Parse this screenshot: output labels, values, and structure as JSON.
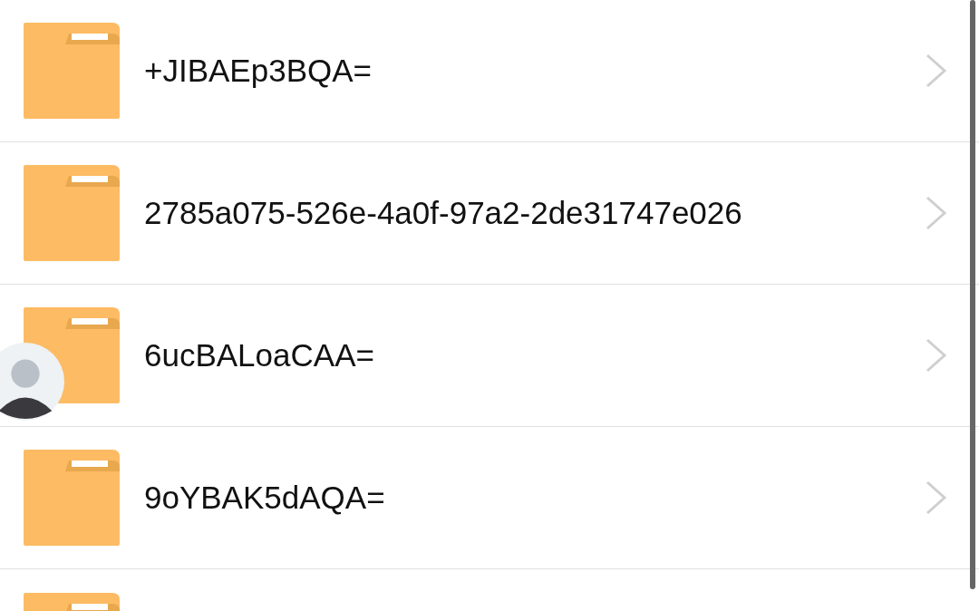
{
  "folders": [
    {
      "kind": "full",
      "name": "+JIBAEp3BQA="
    },
    {
      "kind": "full",
      "name": "2785a075-526e-4a0f-97a2-2de31747e026"
    },
    {
      "kind": "full",
      "name": "6ucBALoaCAA="
    },
    {
      "kind": "full",
      "name": "9oYBAK5dAQA="
    },
    {
      "kind": "cut"
    }
  ],
  "floating_bubble": {
    "kind": "avatar"
  }
}
